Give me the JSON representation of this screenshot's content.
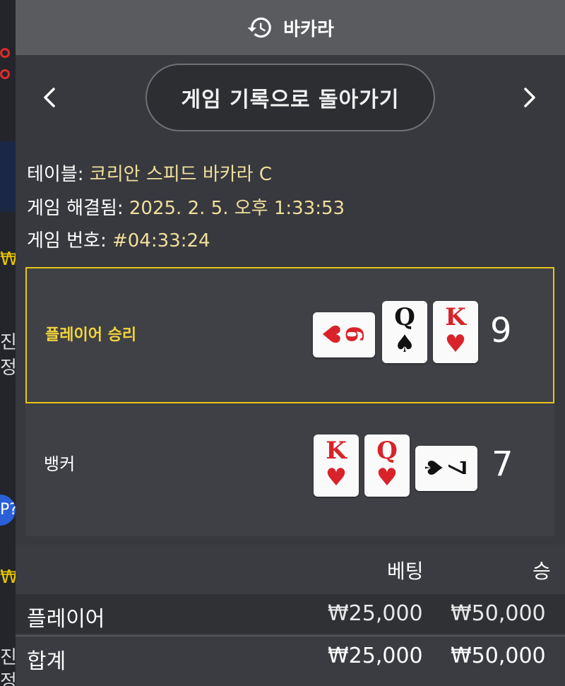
{
  "background": {
    "strip_text": [
      "진",
      "정",
      "진",
      "정"
    ],
    "won_symbol": "₩",
    "pill_text": "P?"
  },
  "header": {
    "title": "바카라",
    "icon": "history-icon"
  },
  "nav": {
    "back_label": "게임 기록으로 돌아가기",
    "prev_icon": "chevron-left-icon",
    "next_icon": "chevron-right-icon"
  },
  "info": {
    "table_label": "테이블:",
    "table_value": "코리안 스피드 바카라 C",
    "resolved_label": "게임 해결됨:",
    "resolved_value": "2025. 2. 5. 오후 1:33:53",
    "game_no_label": "게임 번호:",
    "game_no_value": "#04:33:24"
  },
  "results": {
    "player": {
      "label": "플레이어 승리",
      "score": "9",
      "cards": [
        {
          "rank": "6",
          "suit": "♥",
          "color": "#d8232a",
          "orientation": "horizontal"
        },
        {
          "rank": "Q",
          "suit": "♠",
          "color": "#111111",
          "orientation": "vertical"
        },
        {
          "rank": "K",
          "suit": "♥",
          "color": "#d8232a",
          "orientation": "vertical"
        }
      ]
    },
    "banker": {
      "label": "뱅커",
      "score": "7",
      "cards": [
        {
          "rank": "K",
          "suit": "♥",
          "color": "#d8232a",
          "orientation": "vertical"
        },
        {
          "rank": "Q",
          "suit": "♥",
          "color": "#d8232a",
          "orientation": "vertical"
        },
        {
          "rank": "7",
          "suit": "♠",
          "color": "#111111",
          "orientation": "horizontal"
        }
      ]
    }
  },
  "bets": {
    "headers": {
      "bet": "베팅",
      "win": "승"
    },
    "rows": [
      {
        "name": "플레이어",
        "bet": "₩25,000",
        "win": "₩50,000"
      },
      {
        "name": "합계",
        "bet": "₩25,000",
        "win": "₩50,000"
      }
    ]
  },
  "colors": {
    "accent_yellow": "#e5c519",
    "info_value": "#f1df9c",
    "card_red": "#d8232a"
  }
}
